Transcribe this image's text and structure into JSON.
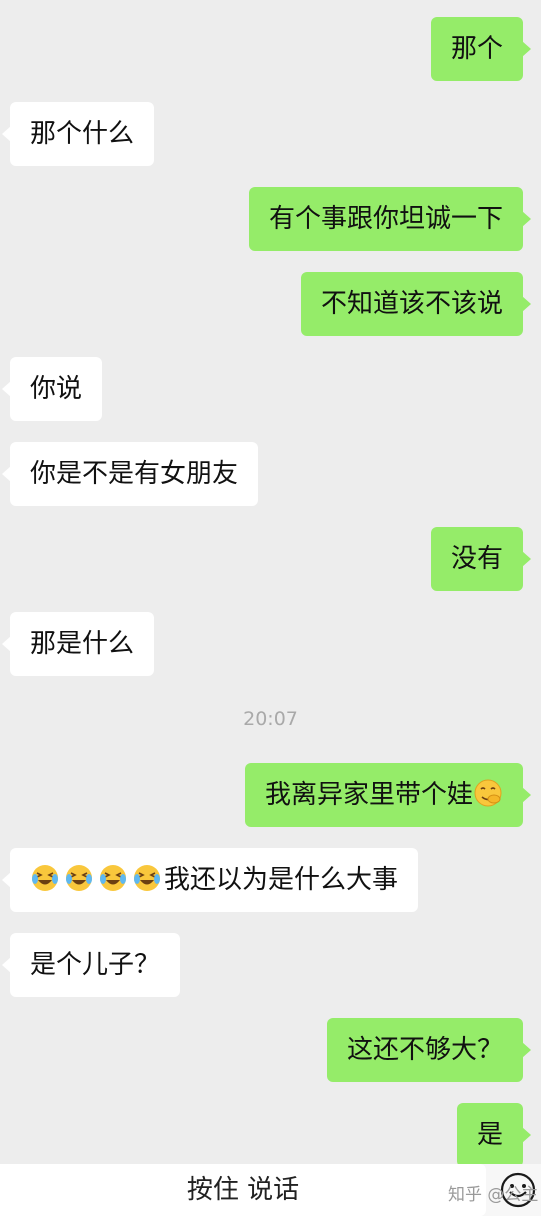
{
  "messages": [
    {
      "side": "right",
      "text": "那个"
    },
    {
      "side": "left",
      "text": "那个什么"
    },
    {
      "side": "right",
      "text": "有个事跟你坦诚一下"
    },
    {
      "side": "right",
      "text": "不知道该不该说"
    },
    {
      "side": "left",
      "text": "你说"
    },
    {
      "side": "left",
      "text": "你是不是有女朋友"
    },
    {
      "side": "right",
      "text": "没有"
    },
    {
      "side": "left",
      "text": "那是什么"
    },
    {
      "side": "right",
      "text": "我离异家里带个娃",
      "emoji": "hand-over-mouth-face-icon"
    },
    {
      "side": "left",
      "text": "我还以为是什么大事",
      "emoji_prefix": "laughing-crying-face-icon",
      "emoji_count": 4
    },
    {
      "side": "left",
      "text": "是个儿子？"
    },
    {
      "side": "right",
      "text": "这还不够大？"
    },
    {
      "side": "right",
      "text": "是"
    }
  ],
  "timestamp": "20:07",
  "input_bar": {
    "hold_to_talk_label": "按住 说话",
    "emoji_button_icon": "emoji-face-icon"
  },
  "watermark": "知乎 @公主",
  "colors": {
    "background": "#ededed",
    "sent_bubble": "#95ec69",
    "received_bubble": "#ffffff",
    "timestamp_text": "#a9a9a9"
  }
}
